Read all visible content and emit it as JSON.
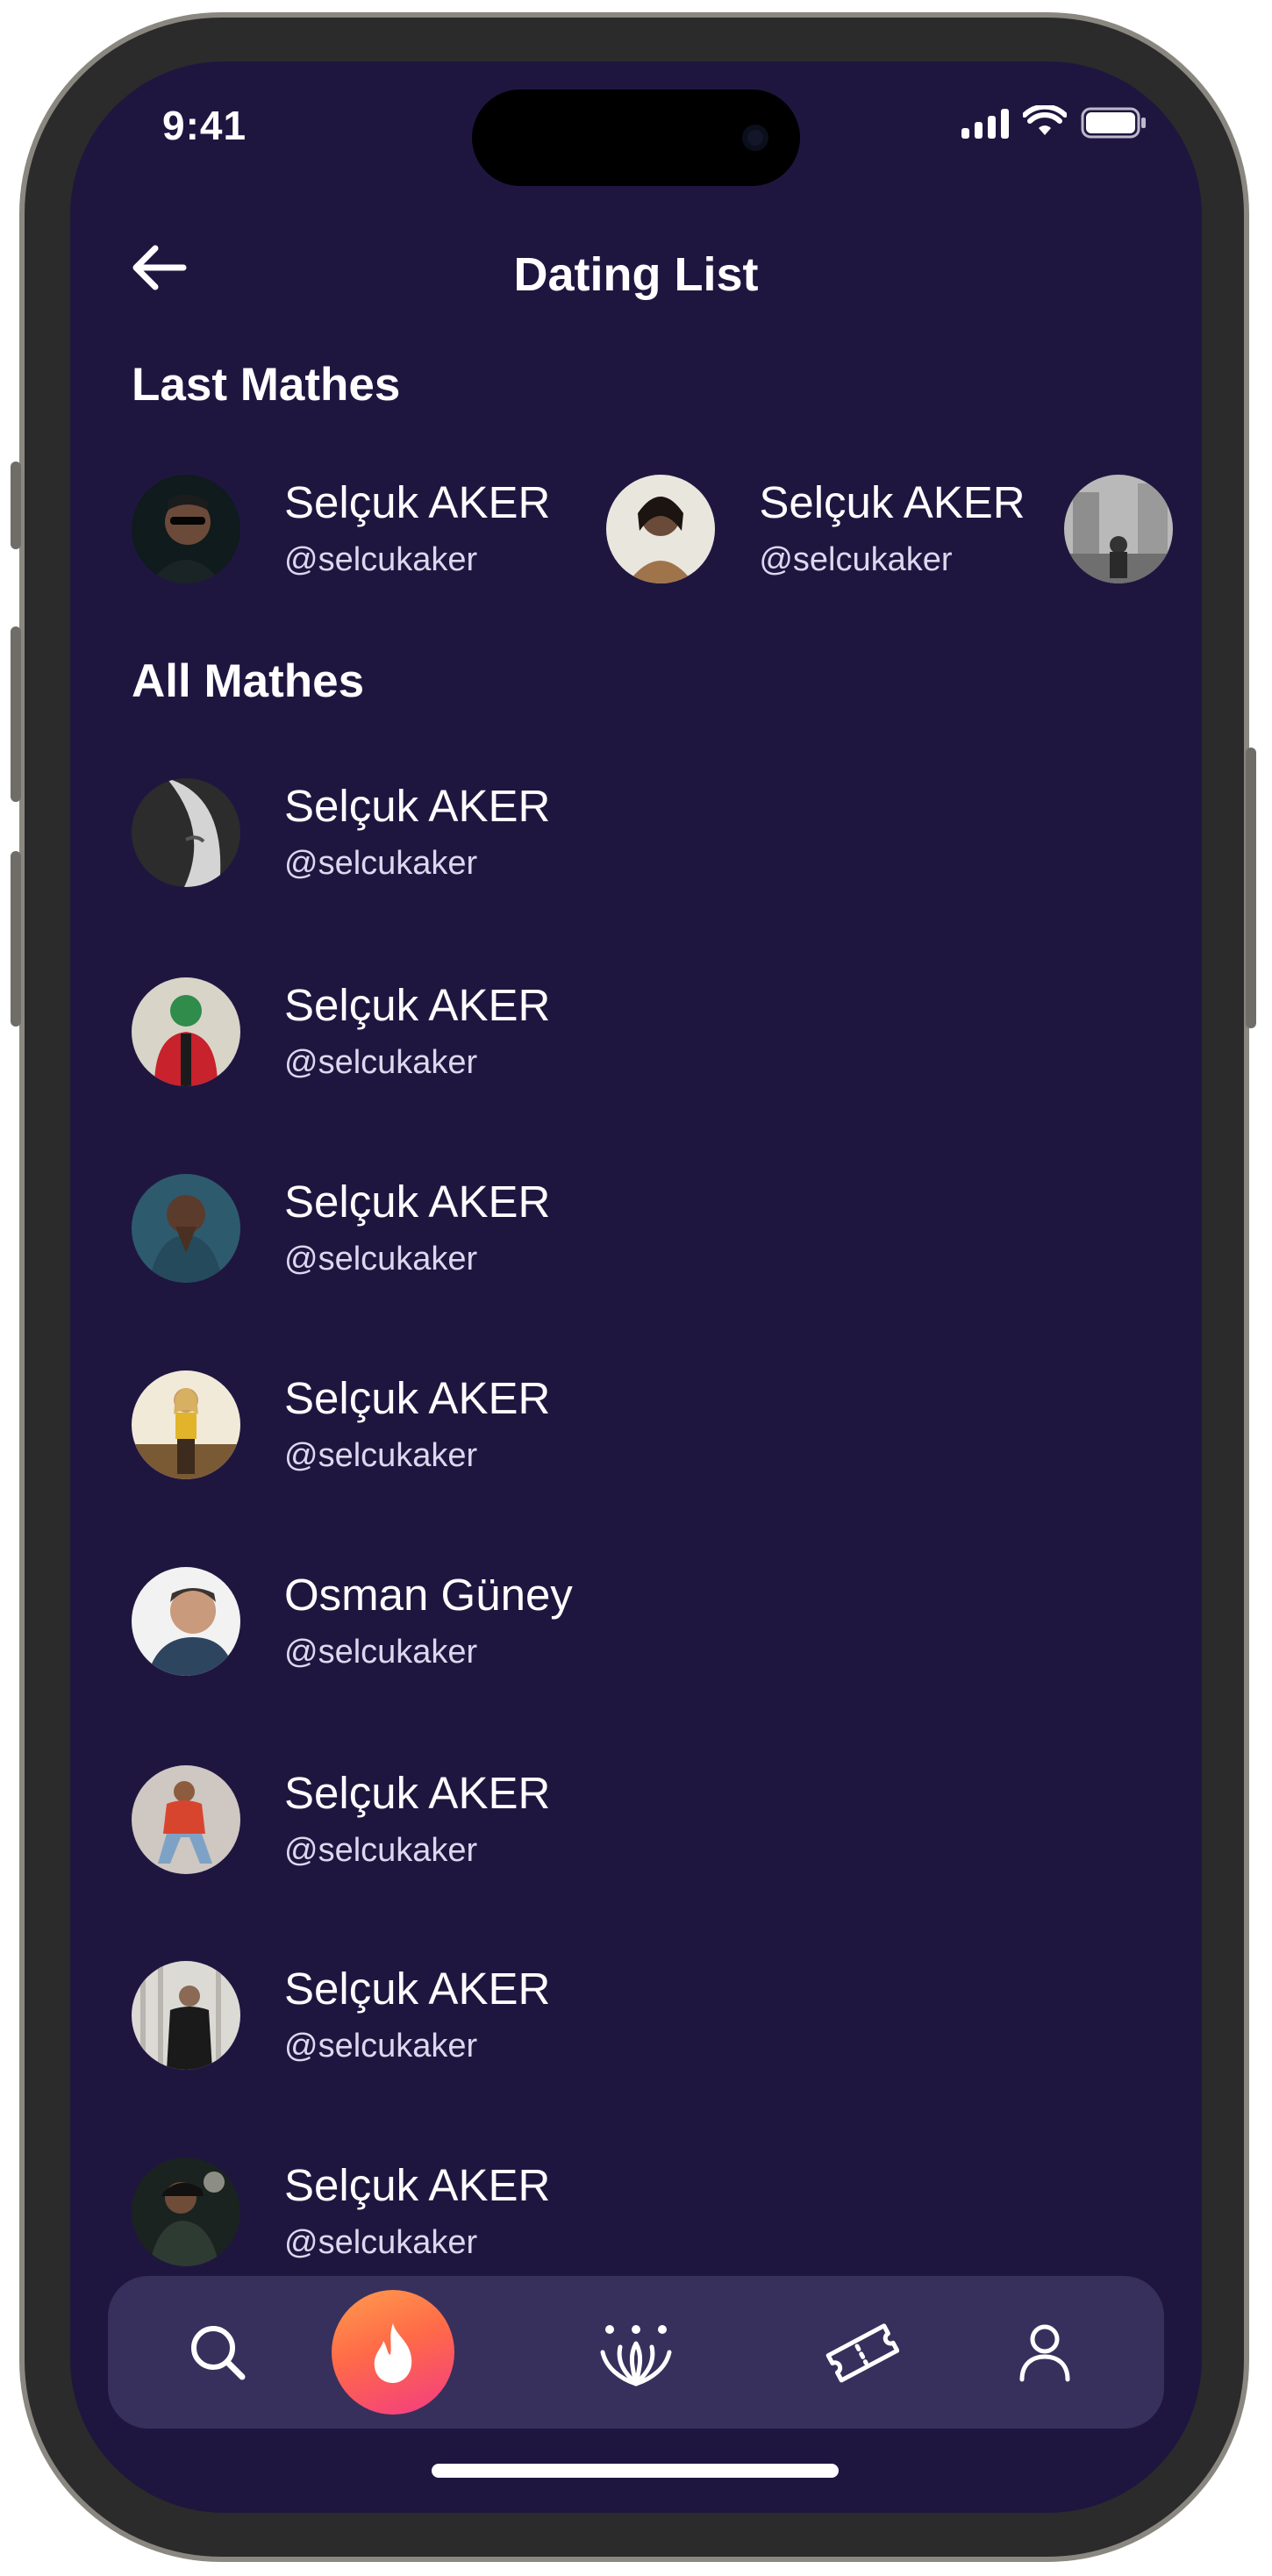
{
  "status_bar": {
    "time": "9:41"
  },
  "header": {
    "title": "Dating List"
  },
  "sections": {
    "last_title": "Last Mathes",
    "all_title": "All Mathes"
  },
  "last_matches": [
    {
      "name": "Selçuk AKER",
      "handle": "@selcukaker",
      "avatar": "man-with-sunglasses-dark"
    },
    {
      "name": "Selçuk AKER",
      "handle": "@selcukaker",
      "avatar": "woman-portrait-light"
    },
    {
      "name": "",
      "handle": "",
      "avatar": "street-scene-grayscale"
    }
  ],
  "all_matches": [
    {
      "name": "Selçuk AKER",
      "handle": "@selcukaker",
      "avatar": "grayscale-face-closeup"
    },
    {
      "name": "Selçuk AKER",
      "handle": "@selcukaker",
      "avatar": "man-red-jacket"
    },
    {
      "name": "Selçuk AKER",
      "handle": "@selcukaker",
      "avatar": "man-hands-folded"
    },
    {
      "name": "Selçuk AKER",
      "handle": "@selcukaker",
      "avatar": "woman-yellow-top-field"
    },
    {
      "name": "Osman Güney",
      "handle": "@selcukaker",
      "avatar": "smiling-man-portrait"
    },
    {
      "name": "Selçuk AKER",
      "handle": "@selcukaker",
      "avatar": "man-sitting-red-jacket"
    },
    {
      "name": "Selçuk AKER",
      "handle": "@selcukaker",
      "avatar": "person-in-black-coat"
    },
    {
      "name": "Selçuk AKER",
      "handle": "@selcukaker",
      "avatar": "man-with-cap-dark"
    }
  ],
  "nav": {
    "items": [
      "search-icon",
      "fire-icon",
      "crown-icon",
      "ticket-icon",
      "user-icon"
    ],
    "active": "fire-icon"
  },
  "colors": {
    "background": "#1f1640",
    "nav_background": "#37305d",
    "accent_gradient_start": "#ff9c4d",
    "accent_gradient_end": "#f23b84"
  }
}
